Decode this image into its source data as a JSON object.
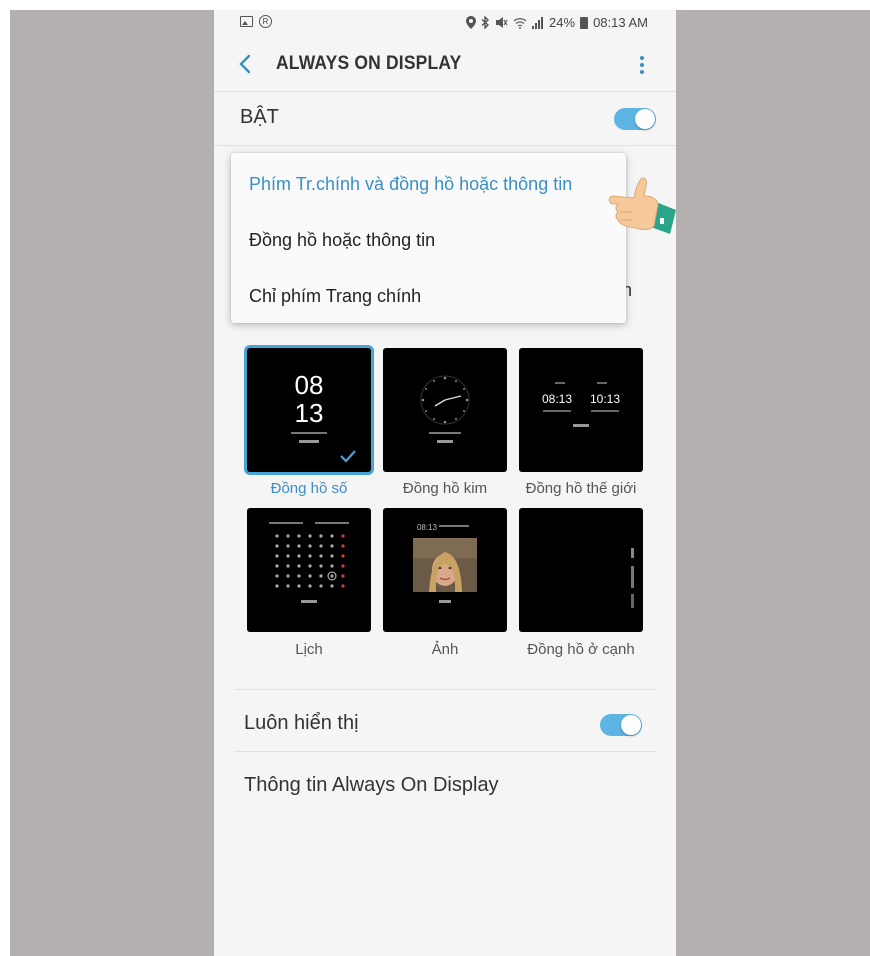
{
  "status_bar": {
    "battery": "24%",
    "time": "08:13 AM"
  },
  "app_bar": {
    "title": "ALWAYS ON DISPLAY"
  },
  "main_toggle": {
    "label": "BẬT",
    "on": true
  },
  "dropdown": {
    "items": [
      {
        "label": "Phím Tr.chính và đồng hồ hoặc thông tin",
        "selected": true
      },
      {
        "label": "Đồng hồ hoặc thông tin",
        "selected": false
      },
      {
        "label": "Chỉ phím Trang chính",
        "selected": false
      }
    ]
  },
  "hidden_row_fragment": "àn",
  "clock_styles": [
    {
      "label": "Đồng hồ số",
      "selected": true,
      "time_hours": "08",
      "time_minutes": "13"
    },
    {
      "label": "Đồng hồ kim",
      "selected": false
    },
    {
      "label": "Đồng hồ thế giới",
      "selected": false,
      "time_left": "08:13",
      "time_right": "10:13"
    },
    {
      "label": "Lịch",
      "selected": false
    },
    {
      "label": "Ảnh",
      "selected": false,
      "time": "08:13"
    },
    {
      "label": "Đồng hồ ở cạnh",
      "selected": false
    }
  ],
  "settings": {
    "always_show": {
      "label": "Luôn hiển thị",
      "on": true
    },
    "info": {
      "label": "Thông tin Always On Display"
    }
  },
  "colors": {
    "accent": "#3a8fc4",
    "toggle": "#5eb4e2",
    "background": "#f5f5f5",
    "side_panel": "#b4b0b0"
  }
}
